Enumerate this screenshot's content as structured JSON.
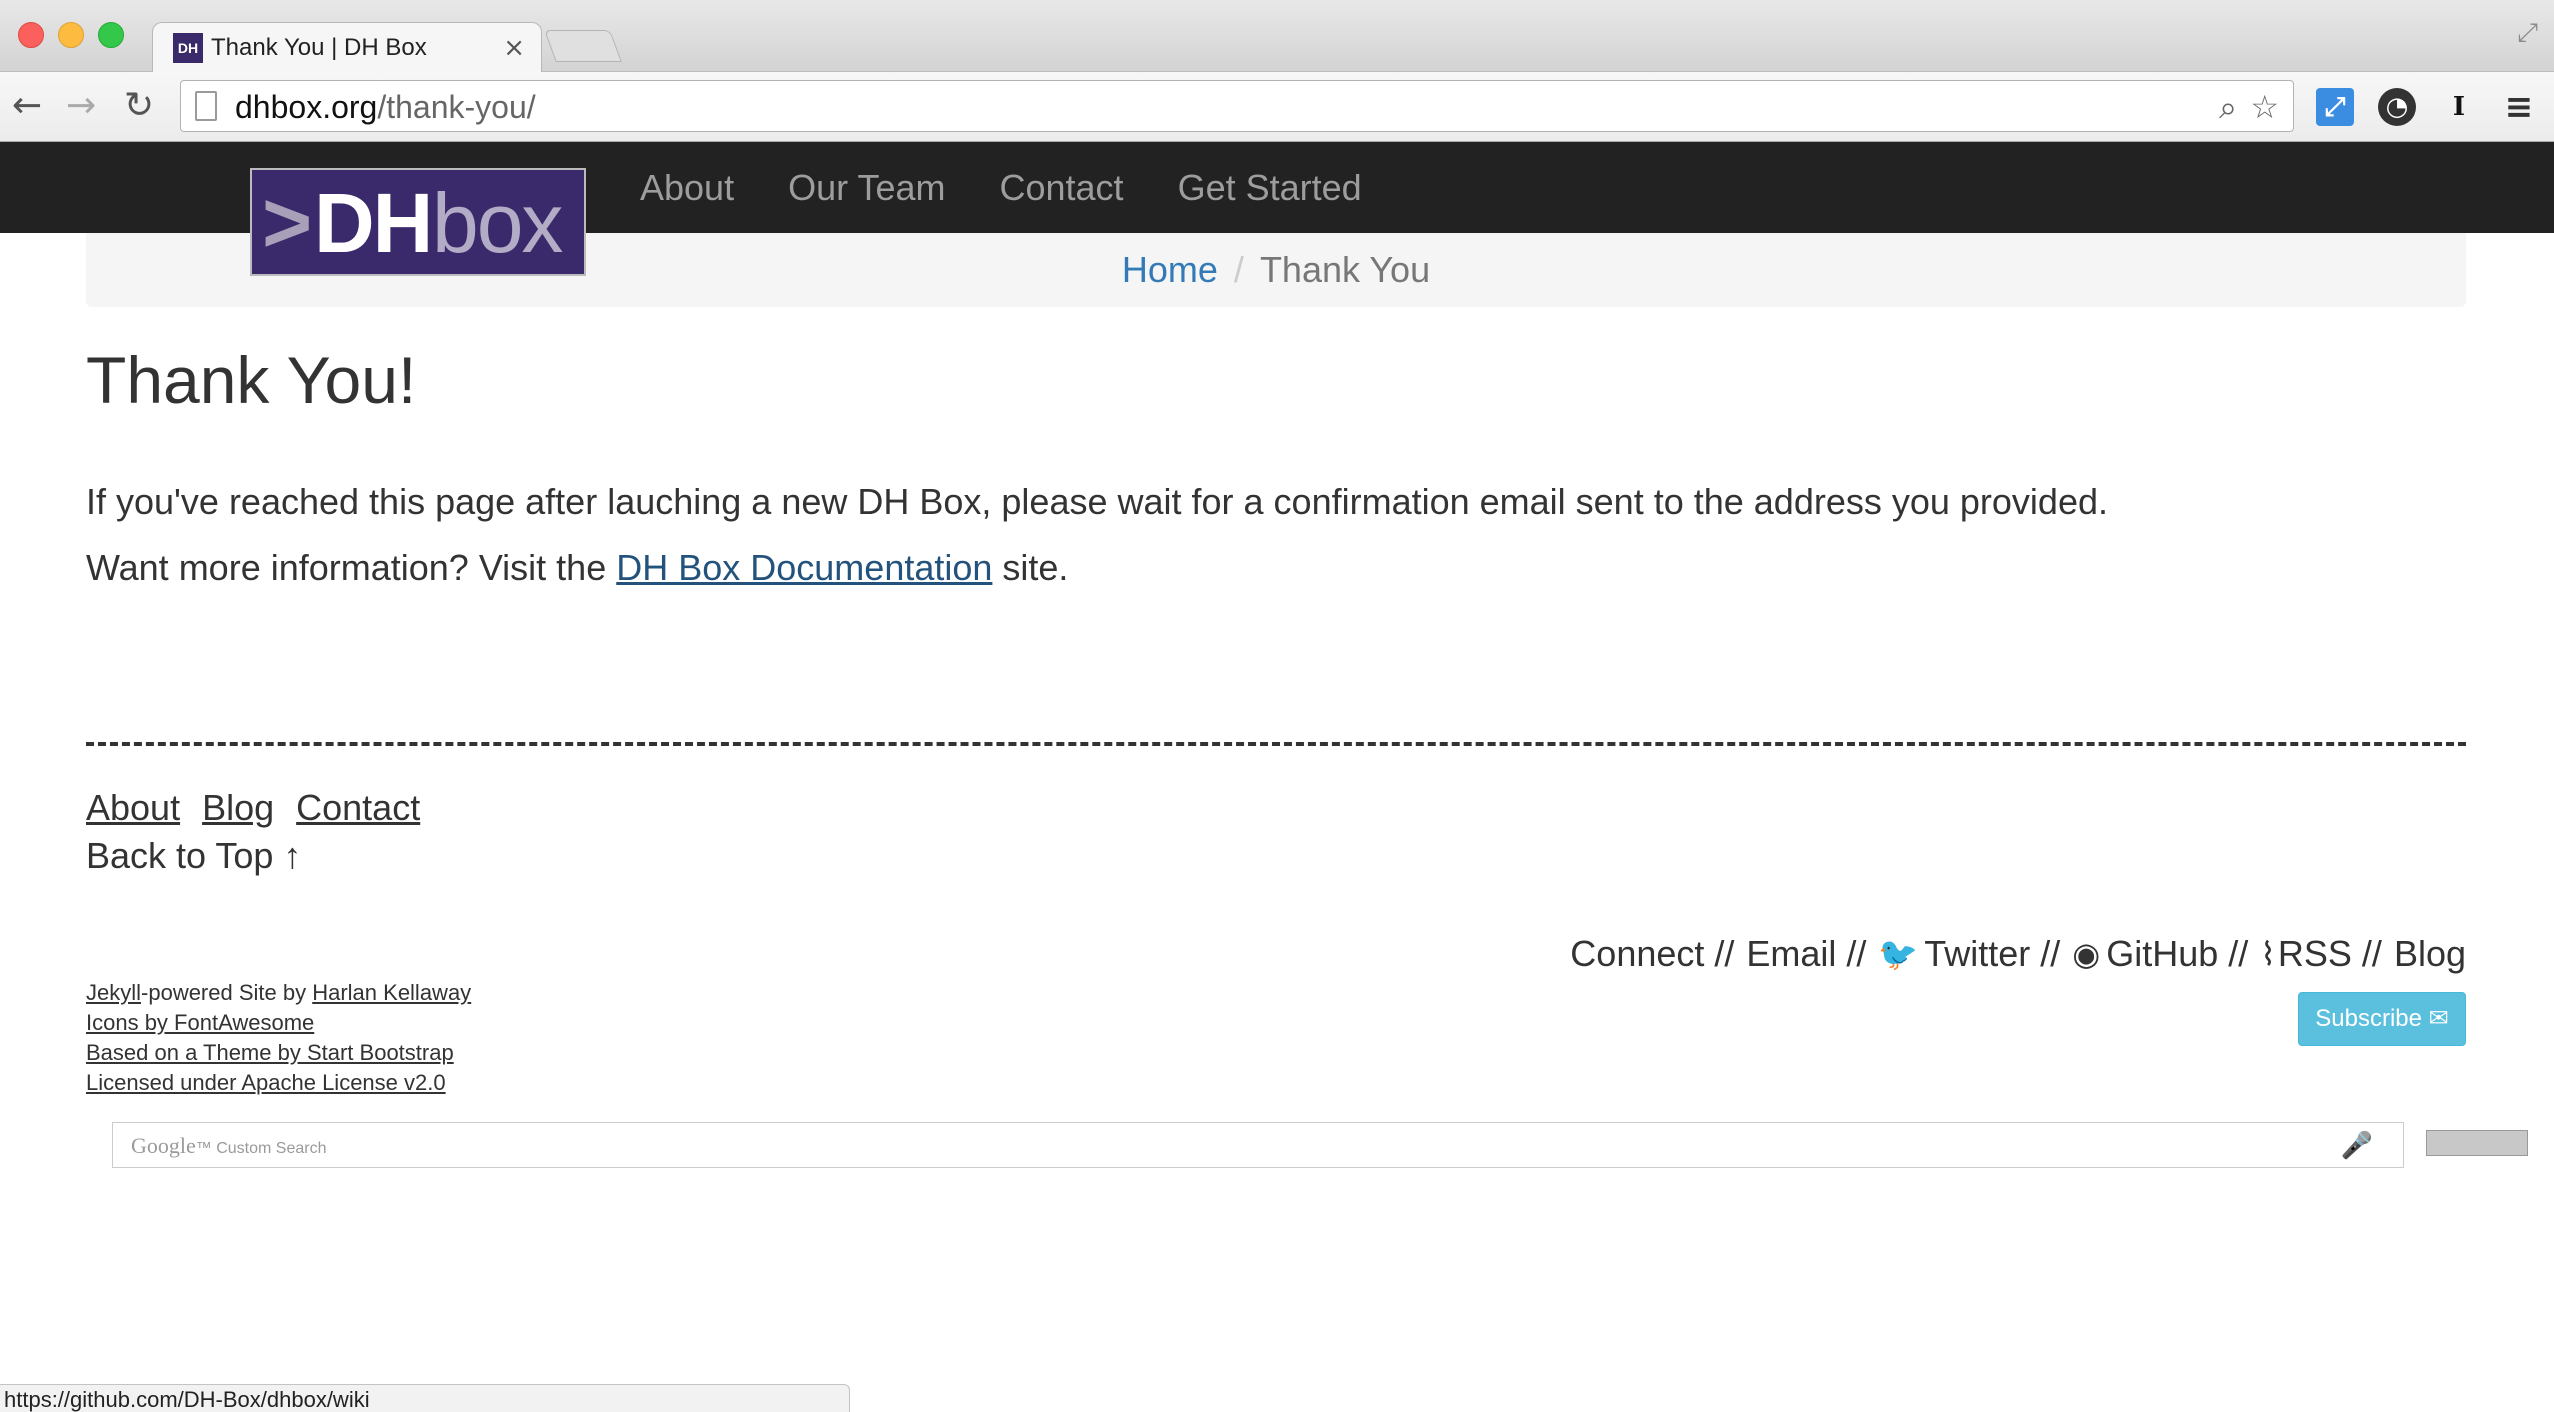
{
  "browser": {
    "tab_favicon": "DH",
    "tab_title": "Thank You | DH Box",
    "tab_close": "×",
    "url_host": "dhbox.org",
    "url_path": "/thank-you/",
    "icons": [
      "back-arrow-icon",
      "forward-arrow-icon",
      "reload-icon",
      "page-icon",
      "zoom-icon",
      "star-icon",
      "extension-icon",
      "history-icon",
      "instapaper-icon",
      "menu-icon"
    ]
  },
  "site_nav": {
    "logo": {
      "chevron": ">",
      "dh": "DH",
      "box": "box"
    },
    "links": [
      "About",
      "Our Team",
      "Contact",
      "Get Started"
    ]
  },
  "breadcrumb": {
    "home": "Home",
    "separator": "/",
    "current": "Thank You"
  },
  "main": {
    "title": "Thank You!",
    "paragraph1": "If you've reached this page after lauching a new DH Box, please wait for a confirmation email sent to the address you provided.",
    "paragraph2_prefix": "Want more information? Visit the ",
    "paragraph2_link": "DH Box Documentation",
    "paragraph2_suffix": " site."
  },
  "footer": {
    "links": [
      "About",
      "Blog",
      "Contact"
    ],
    "back_to_top": "Back to Top ↑",
    "connect": {
      "label": "Connect // ",
      "email": "Email //",
      "twitter": "Twitter //",
      "github": "GitHub //",
      "rss": "RSS // ",
      "blog": "Blog"
    },
    "credits": {
      "jekyll": "Jekyll",
      "powered_by": "-powered Site by ",
      "author": "Harlan Kellaway",
      "icons": "Icons by FontAwesome",
      "theme": "Based on a Theme by Start Bootstrap ",
      "license": "Licensed under Apache License v2.0"
    },
    "subscribe": "Subscribe ✉"
  },
  "google_search": {
    "brand": "Google",
    "tm": "™",
    "label": " Custom Search"
  },
  "status_bar": "https://github.com/DH-Box/dhbox/wiki"
}
